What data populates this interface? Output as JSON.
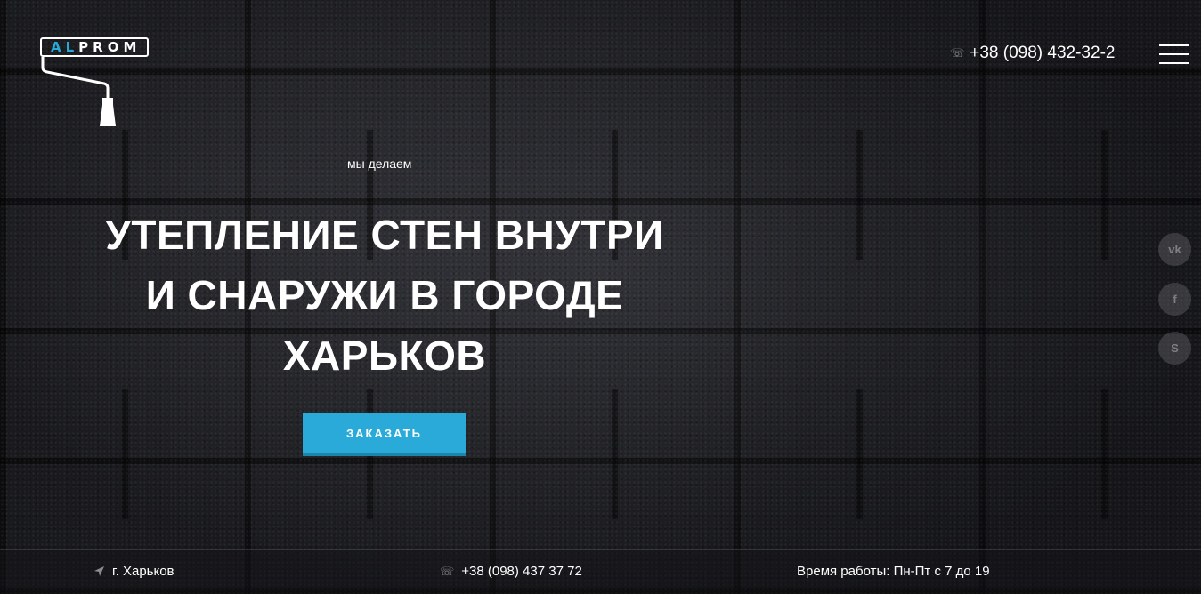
{
  "logo": {
    "part1": "AL",
    "part2": "PROM",
    "accent_color": "#27a9d9"
  },
  "header": {
    "phone_icon": "phone-icon",
    "phone": "+38 (098) 432-32-2",
    "menu_icon": "hamburger-menu-icon"
  },
  "hero": {
    "subtitle": "мы делаем",
    "headline_lines": [
      "УТЕПЛЕНИЕ СТЕН ВНУТРИ",
      "И СНАРУЖИ В ГОРОДЕ",
      "ХАРЬКОВ"
    ],
    "button_label": "ЗАКАЗАТЬ",
    "button_color": "#29aad8"
  },
  "social": [
    {
      "icon": "vk-icon",
      "label": "vk"
    },
    {
      "icon": "facebook-icon",
      "label": "f"
    },
    {
      "icon": "skype-icon",
      "label": "S"
    }
  ],
  "footer": {
    "city_icon": "location-arrow-icon",
    "city": "г. Харьков",
    "phone_icon": "phone-icon",
    "phone": "+38 (098) 437 37 72",
    "hours": "Время работы: Пн-Пт с 7 до 19"
  }
}
